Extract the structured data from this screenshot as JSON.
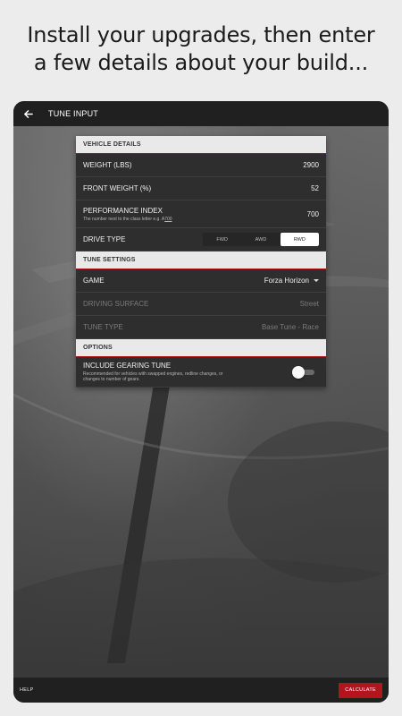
{
  "promo": {
    "line1": "Install your upgrades, then enter",
    "line2": "a few details about your build..."
  },
  "appbar": {
    "title": "TUNE INPUT",
    "back_icon": "arrow-left-icon"
  },
  "vehicle_details": {
    "header": "VEHICLE DETAILS",
    "weight_label": "WEIGHT (LBS)",
    "weight_value": "2900",
    "front_weight_label": "FRONT WEIGHT (%)",
    "front_weight_value": "52",
    "pi_label": "PERFORMANCE INDEX",
    "pi_sub_prefix": "The number next to the class letter e.g. A",
    "pi_sub_example": "700",
    "pi_value": "700",
    "drive_type_label": "DRIVE TYPE",
    "drive_options": [
      "FWD",
      "AWD",
      "RWD"
    ],
    "drive_selected": "RWD"
  },
  "tune_settings": {
    "header": "TUNE SETTINGS",
    "game_label": "GAME",
    "game_value": "Forza Horizon",
    "surface_label": "DRIVING SURFACE",
    "surface_value": "Street",
    "tune_type_label": "TUNE TYPE",
    "tune_type_value": "Base Tune - Race"
  },
  "options": {
    "header": "OPTIONS",
    "gearing_label": "INCLUDE GEARING TUNE",
    "gearing_sub": "Recommended for vehicles with swapped engines, redline changes, or changes to number of gears.",
    "gearing_enabled": false
  },
  "bottombar": {
    "help_label": "HELP",
    "calculate_label": "CALCULATE"
  },
  "colors": {
    "accent": "#b3141d",
    "bar": "#202020",
    "panel": "#2e2e2e"
  }
}
